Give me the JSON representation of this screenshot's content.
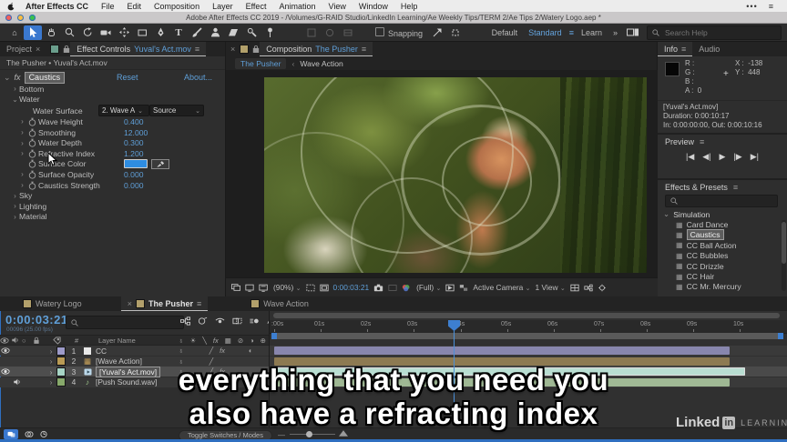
{
  "colors": {
    "accent_blue": "#5f9fd8",
    "tool_active_blue": "#3a78cf",
    "playhead_blue": "#3d7fd0",
    "panel_bg": "#2e2e2e",
    "surface_color_swatch": "#2e8de2",
    "traffic_red": "#f4605a",
    "traffic_yellow": "#fbbd3f",
    "traffic_green": "#3ac24c"
  },
  "icons": {
    "menu": "≡",
    "close": "×",
    "chevron_down": "⌄",
    "chevron_right": "›",
    "double_chevron": "»",
    "dropdown": "⌄",
    "crosshair": "+",
    "fx": "fx",
    "home": "⌂",
    "text_tool": "T",
    "more": "•••",
    "crumb_sep": "‹"
  },
  "menubar": {
    "items": [
      "After Effects CC",
      "File",
      "Edit",
      "Composition",
      "Layer",
      "Effect",
      "Animation",
      "View",
      "Window",
      "Help"
    ]
  },
  "titlebar": {
    "title": "Adobe After Effects CC 2019 - /Volumes/G-RAID Studio/LinkedIn Learning/Ae Weekly Tips/TERM 2/Ae Tips 2/Watery Logo.aep *"
  },
  "toolbar": {
    "snapping_label": "Snapping",
    "workspace_default": "Default",
    "workspace_standard": "Standard",
    "workspace_learn": "Learn",
    "search_placeholder": "Search Help"
  },
  "effect_controls": {
    "tab_project": "Project",
    "tab_label": "Effect Controls",
    "tab_clip": "Yuval's Act.mov",
    "source_line": "The Pusher • Yuval's Act.mov",
    "effect_name": "Caustics",
    "reset_label": "Reset",
    "about_label": "About...",
    "rows": {
      "bottom": "Bottom",
      "water": "Water",
      "water_surface": "Water Surface",
      "water_surface_value": "2. Wave A",
      "water_surface_source": "Source",
      "wave_height": "Wave Height",
      "wave_height_value": "0.400",
      "smoothing": "Smoothing",
      "smoothing_value": "12.000",
      "water_depth": "Water Depth",
      "water_depth_value": "0.300",
      "refractive_index": "Refractive Index",
      "refractive_index_value": "1.200",
      "surface_color": "Surface Color",
      "surface_opacity": "Surface Opacity",
      "surface_opacity_value": "0.000",
      "caustics_strength": "Caustics Strength",
      "caustics_strength_value": "0.000",
      "sky": "Sky",
      "lighting": "Lighting",
      "material": "Material"
    }
  },
  "composition": {
    "tab_label": "Composition",
    "tab_comp": "The Pusher",
    "crumb_active": "The Pusher",
    "crumb_parent": "Wave Action",
    "zoom": "(90%)",
    "timecode": "0:00:03:21",
    "resolution": "(Full)",
    "camera": "Active Camera",
    "view": "1 View"
  },
  "info": {
    "tab_info": "Info",
    "tab_audio": "Audio",
    "r_label": "R :",
    "g_label": "G :",
    "b_label": "B :",
    "a_label": "A :",
    "a_value": "0",
    "x_label": "X :",
    "x_value": "-138",
    "y_label": "Y :",
    "y_value": "448",
    "clip": "[Yuval's Act.mov]",
    "duration": "Duration: 0:00:10:17",
    "in_out": "In: 0:00:00:00, Out: 0:00:10:16"
  },
  "preview": {
    "title": "Preview",
    "buttons": [
      "|◀",
      "◀|",
      "▶",
      "|▶",
      "▶|"
    ]
  },
  "effects_presets": {
    "title": "Effects & Presets",
    "category": "Simulation",
    "items": [
      "Card Dance",
      "Caustics",
      "CC Ball Action",
      "CC Bubbles",
      "CC Drizzle",
      "CC Hair",
      "CC Mr. Mercury"
    ]
  },
  "timeline": {
    "tabs": [
      "Watery Logo",
      "The Pusher",
      "Wave Action"
    ],
    "timecode": "0:00:03:21",
    "frame_info": "00096 (25.00 fps)",
    "col_hash": "#",
    "col_layer_name": "Layer Name",
    "layers": [
      {
        "num": "1",
        "name": "CC",
        "label_color": "#9d9bc9",
        "bar_color": "#8886ad"
      },
      {
        "num": "2",
        "name": "[Wave Action]",
        "label_color": "#b99b55",
        "bar_color": "#8d7a52"
      },
      {
        "num": "3",
        "name": "[Yuval's Act.mov]",
        "label_color": "#a7d4c5",
        "bar_color": "#b9ded2"
      },
      {
        "num": "4",
        "name": "[Push Sound.wav]",
        "label_color": "#87a96b",
        "bar_color": "#9fb894"
      }
    ],
    "ruler": [
      ":00s",
      "01s",
      "02s",
      "03s",
      "04s",
      "05s",
      "06s",
      "07s",
      "08s",
      "09s",
      "10s"
    ],
    "toggle_label": "Toggle Switches / Modes"
  },
  "subtitles": {
    "line1": "everything that you need you",
    "line2": "also have a refracting index"
  },
  "branding": {
    "linked": "Linked",
    "in": "in",
    "learning": "LEARNING"
  }
}
